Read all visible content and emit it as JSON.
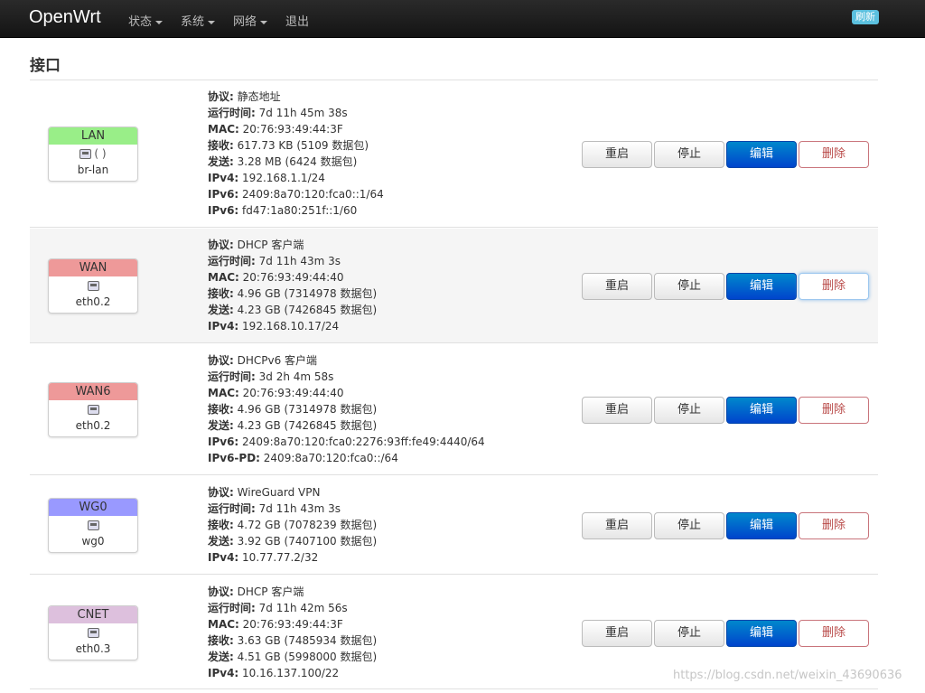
{
  "navbar": {
    "brand": "OpenWrt",
    "menu": [
      {
        "label": "状态"
      },
      {
        "label": "系统"
      },
      {
        "label": "网络"
      },
      {
        "label": "退出"
      }
    ],
    "refresh_badge": "刷新"
  },
  "page": {
    "title": "接口"
  },
  "buttons": {
    "restart": "重启",
    "stop": "停止",
    "edit": "编辑",
    "delete": "删除"
  },
  "interfaces": [
    {
      "name": "LAN",
      "color": "#99ee88",
      "icons": "(   )",
      "device": "br-lan",
      "lines": [
        {
          "k": "协议:",
          "v": " 静态地址"
        },
        {
          "k": "运行时间:",
          "v": " 7d 11h 45m 38s"
        },
        {
          "k": "MAC:",
          "v": " 20:76:93:49:44:3F"
        },
        {
          "k": "接收:",
          "v": " 617.73 KB (5109 数据包)"
        },
        {
          "k": "发送:",
          "v": " 3.28 MB (6424 数据包)"
        },
        {
          "k": "IPv4:",
          "v": " 192.168.1.1/24"
        },
        {
          "k": "IPv6:",
          "v": " 2409:8a70:120:fca0::1/64"
        },
        {
          "k": "IPv6:",
          "v": " fd47:1a80:251f::1/60"
        }
      ]
    },
    {
      "name": "WAN",
      "color": "#ee9999",
      "icons": "",
      "device": "eth0.2",
      "lines": [
        {
          "k": "协议:",
          "v": " DHCP 客户端"
        },
        {
          "k": "运行时间:",
          "v": " 7d 11h 43m 3s"
        },
        {
          "k": "MAC:",
          "v": " 20:76:93:49:44:40"
        },
        {
          "k": "接收:",
          "v": " 4.96 GB (7314978 数据包)"
        },
        {
          "k": "发送:",
          "v": " 4.23 GB (7426845 数据包)"
        },
        {
          "k": "IPv4:",
          "v": " 192.168.10.17/24"
        }
      ]
    },
    {
      "name": "WAN6",
      "color": "#ee9999",
      "icons": "",
      "device": "eth0.2",
      "lines": [
        {
          "k": "协议:",
          "v": " DHCPv6 客户端"
        },
        {
          "k": "运行时间:",
          "v": " 3d 2h 4m 58s"
        },
        {
          "k": "MAC:",
          "v": " 20:76:93:49:44:40"
        },
        {
          "k": "接收:",
          "v": " 4.96 GB (7314978 数据包)"
        },
        {
          "k": "发送:",
          "v": " 4.23 GB (7426845 数据包)"
        },
        {
          "k": "IPv6:",
          "v": " 2409:8a70:120:fca0:2276:93ff:fe49:4440/64"
        },
        {
          "k": "IPv6-PD:",
          "v": " 2409:8a70:120:fca0::/64"
        }
      ]
    },
    {
      "name": "WG0",
      "color": "#9999ff",
      "icons": "",
      "device": "wg0",
      "lines": [
        {
          "k": "协议:",
          "v": " WireGuard VPN"
        },
        {
          "k": "运行时间:",
          "v": " 7d 11h 43m 3s"
        },
        {
          "k": "接收:",
          "v": " 4.72 GB (7078239 数据包)"
        },
        {
          "k": "发送:",
          "v": " 3.92 GB (7407100 数据包)"
        },
        {
          "k": "IPv4:",
          "v": " 10.77.77.2/32"
        }
      ]
    },
    {
      "name": "CNET",
      "color": "#ddc0dd",
      "icons": "",
      "device": "eth0.3",
      "lines": [
        {
          "k": "协议:",
          "v": " DHCP 客户端"
        },
        {
          "k": "运行时间:",
          "v": " 7d 11h 42m 56s"
        },
        {
          "k": "MAC:",
          "v": " 20:76:93:49:44:3F"
        },
        {
          "k": "接收:",
          "v": " 3.63 GB (7485934 数据包)"
        },
        {
          "k": "发送:",
          "v": " 4.51 GB (5998000 数据包)"
        },
        {
          "k": "IPv4:",
          "v": " 10.16.137.100/22"
        }
      ]
    }
  ],
  "watermark": "https://blog.csdn.net/weixin_43690636"
}
